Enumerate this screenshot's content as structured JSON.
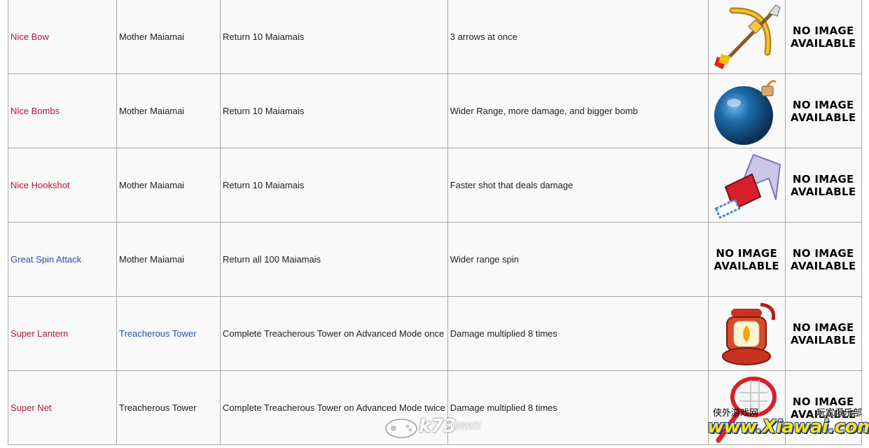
{
  "no_image_text": [
    "NO IMAGE",
    "AVAILABLE"
  ],
  "colors": {
    "red_link": "#b31537",
    "blue_link": "#2b4ea8",
    "border": "#a8a8a8",
    "cell_bg": "#f9f9f9"
  },
  "rows": [
    {
      "item": "Nice Bow",
      "item_link": "red",
      "source": "Mother Maiamai",
      "source_link": "plain",
      "requirement": "Return 10 Maiamais",
      "effect": "3 arrows at once",
      "icon": "bow-icon"
    },
    {
      "item": "Nice Bombs",
      "item_link": "red",
      "source": "Mother Maiamai",
      "source_link": "plain",
      "requirement": "Return 10 Maiamais",
      "effect": "Wider Range, more damage, and bigger bomb",
      "icon": "bomb-icon"
    },
    {
      "item": "Nice Hookshot",
      "item_link": "red",
      "source": "Mother Maiamai",
      "source_link": "plain",
      "requirement": "Return 10 Maiamais",
      "effect": "Faster shot that deals damage",
      "icon": "hookshot-icon"
    },
    {
      "item": "Great Spin Attack",
      "item_link": "blue",
      "source": "Mother Maiamai",
      "source_link": "plain",
      "requirement": "Return all 100 Maiamais",
      "effect": "Wider range spin",
      "icon": ""
    },
    {
      "item": "Super Lantern",
      "item_link": "red",
      "source": "Treacherous Tower",
      "source_link": "blue",
      "requirement": "Complete Treacherous Tower on Advanced Mode once",
      "effect": "Damage multiplied 8 times",
      "icon": "lantern-icon"
    },
    {
      "item": "Super Net",
      "item_link": "red",
      "source": "Treacherous Tower",
      "source_link": "plain",
      "requirement": "Complete Treacherous Tower on Advanced Mode twice",
      "effect": "Damage multiplied 8 times",
      "icon": "net-icon"
    }
  ],
  "watermarks": {
    "k73": "k73",
    "k73_sub": "电玩之家",
    "xiawai_left": "侠外游戏网",
    "xiawai_right": "玩家俱乐部",
    "xiawai_url": "www.Xiawai.com"
  }
}
